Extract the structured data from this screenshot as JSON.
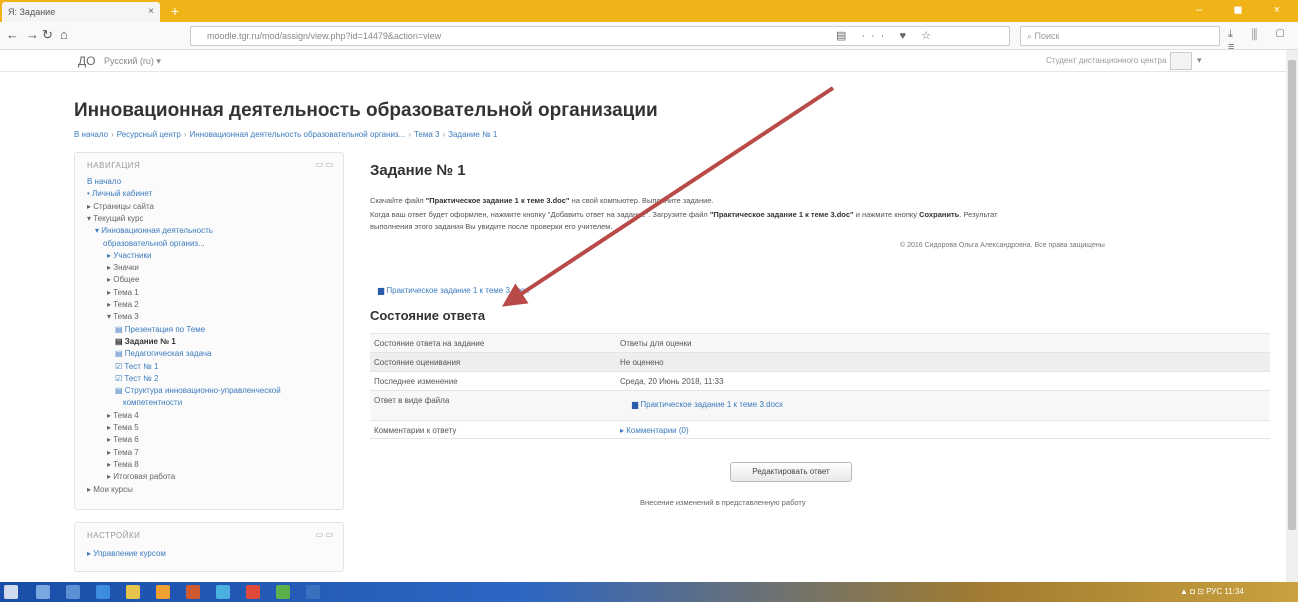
{
  "browser": {
    "tab_title": "Я: Задание",
    "tab_close": "×",
    "new_tab": "+",
    "window_controls": "– ◼ ×",
    "url": "moodle.tgr.ru/mod/assign/view.php?id=14479&action=view",
    "url_icons": "▤ ··· ♥ ☆",
    "search_placeholder": "Поиск",
    "toolbar_icons": "⤓ ⫼ ▢ ≡"
  },
  "moodle_header": {
    "brand": "ДО",
    "language": "Русский (ru) ▾",
    "user": "Студент дистанционного центра",
    "user_menu": "▾"
  },
  "page": {
    "title": "Инновационная деятельность образовательной организации",
    "breadcrumbs": [
      "В начало",
      "Ресурсный центр",
      "Инновационная деятельность образовательной организ...",
      "Тема 3",
      "Задание № 1"
    ]
  },
  "navigation": {
    "header": "НАВИГАЦИЯ",
    "header_icons": "▭ ▭",
    "items": [
      {
        "label": "В начало",
        "style": "link"
      },
      {
        "label": "• Личный кабинет",
        "style": "link"
      },
      {
        "label": "▸ Страницы сайта",
        "style": "plain"
      },
      {
        "label": "▾ Текущий курс",
        "style": "plain"
      },
      {
        "label": "▾ Инновационная деятельность",
        "style": "link"
      },
      {
        "label": "образовательной организ...",
        "style": "link"
      },
      {
        "label": "▸ Участники",
        "style": "link"
      },
      {
        "label": "▸ Значки",
        "style": "plain"
      },
      {
        "label": "▸ Общее",
        "style": "plain"
      },
      {
        "label": "▸ Тема 1",
        "style": "plain"
      },
      {
        "label": "▸ Тема 2",
        "style": "plain"
      },
      {
        "label": "▾ Тема 3",
        "style": "plain"
      },
      {
        "label": "▤ Презентация по Теме",
        "style": "link"
      },
      {
        "label": "▤ Задание № 1",
        "style": "current"
      },
      {
        "label": "▤ Педагогическая задача",
        "style": "link"
      },
      {
        "label": "☑ Тест № 1",
        "style": "link"
      },
      {
        "label": "☑ Тест № 2",
        "style": "link"
      },
      {
        "label": "▤ Структура инновационно-управленческой",
        "style": "link"
      },
      {
        "label": "компетентности",
        "style": "link"
      },
      {
        "label": "▸ Тема 4",
        "style": "plain"
      },
      {
        "label": "▸ Тема 5",
        "style": "plain"
      },
      {
        "label": "▸ Тема 6",
        "style": "plain"
      },
      {
        "label": "▸ Тема 7",
        "style": "plain"
      },
      {
        "label": "▸ Тема 8",
        "style": "plain"
      },
      {
        "label": "▸ Итоговая работа",
        "style": "plain"
      },
      {
        "label": "▸ Мои курсы",
        "style": "plain"
      }
    ]
  },
  "settings": {
    "header": "НАСТРОЙКИ",
    "header_icons": "▭ ▭",
    "item": "▸ Управление курсом"
  },
  "assignment": {
    "heading": "Задание № 1",
    "line1_a": "Скачайте файл ",
    "line1_b": "\"Практическое задание 1 к теме 3.doc\"",
    "line1_c": " на свой компьютер. Выполните задание.",
    "line2_a": "Когда ваш ответ будет оформлен, нажмите кнопку \"Добавить ответ на задание\". Загрузите файл ",
    "line2_b": "\"Практическое задание 1 к теме 3.doc\"",
    "line2_c": " и нажмите кнопку ",
    "line2_d": "Сохранить",
    "line2_e": ". Результат",
    "line3": "выполнения этого задания Вы увидите после проверки его учителем.",
    "copyright": "© 2016 Сидорова Ольга Александровна. Все права защищены",
    "file": "Практическое задание 1 к теме 3.docx"
  },
  "status": {
    "heading": "Состояние ответа",
    "rows": [
      {
        "label": "Состояние ответа на задание",
        "value": "Ответы для оценки"
      },
      {
        "label": "Состояние оценивания",
        "value": "Не оценено"
      },
      {
        "label": "Последнее изменение",
        "value": "Среда, 20 Июнь 2018, 11:33"
      },
      {
        "label": "Ответ в виде файла",
        "value": "Практическое задание 1 к теме 3.docx"
      },
      {
        "label": "Комментарии к ответу",
        "value": "▸ Комментарии (0)"
      }
    ],
    "edit_button": "Редактировать ответ",
    "note": "Внесение изменений в представленную работу"
  },
  "taskbar": {
    "tray": "▲ ◘ ⊡ РУС 11:34"
  },
  "colors": {
    "titlebar": "#f0b419",
    "link": "#3b7bbf",
    "arrow": "#b84a47"
  }
}
